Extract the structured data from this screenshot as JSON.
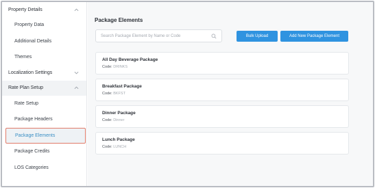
{
  "sidebar": {
    "sections": [
      {
        "label": "Property Details",
        "items": [
          "Property Data",
          "Additional Details",
          "Themes"
        ]
      },
      {
        "label": "Localization Settings",
        "items": []
      },
      {
        "label": "Rate Plan Setup",
        "items": [
          "Rate Setup",
          "Package Headers",
          "Package Elements",
          "Package Credits",
          "LOS Categories"
        ]
      }
    ],
    "selected_item": "Package Elements"
  },
  "main": {
    "title": "Package Elements",
    "search_placeholder": "Search Package Element by Name or Code",
    "bulk_upload_label": "Bulk Upload",
    "add_label": "Add New Package Element",
    "code_label": "Code:",
    "elements": [
      {
        "name": "All Day Beverage Package",
        "code": "DRINKS"
      },
      {
        "name": "Breakfast Package",
        "code": "BKFST"
      },
      {
        "name": "Dinner Package",
        "code": "Dinner"
      },
      {
        "name": "Lunch Package",
        "code": "LUNCH"
      }
    ]
  },
  "icons": {
    "search": "search-icon",
    "chevron": "chevron-icon"
  },
  "colors": {
    "accent": "#2f93e0",
    "selected_text": "#3a8fc4",
    "highlight_border": "#e07a68"
  }
}
